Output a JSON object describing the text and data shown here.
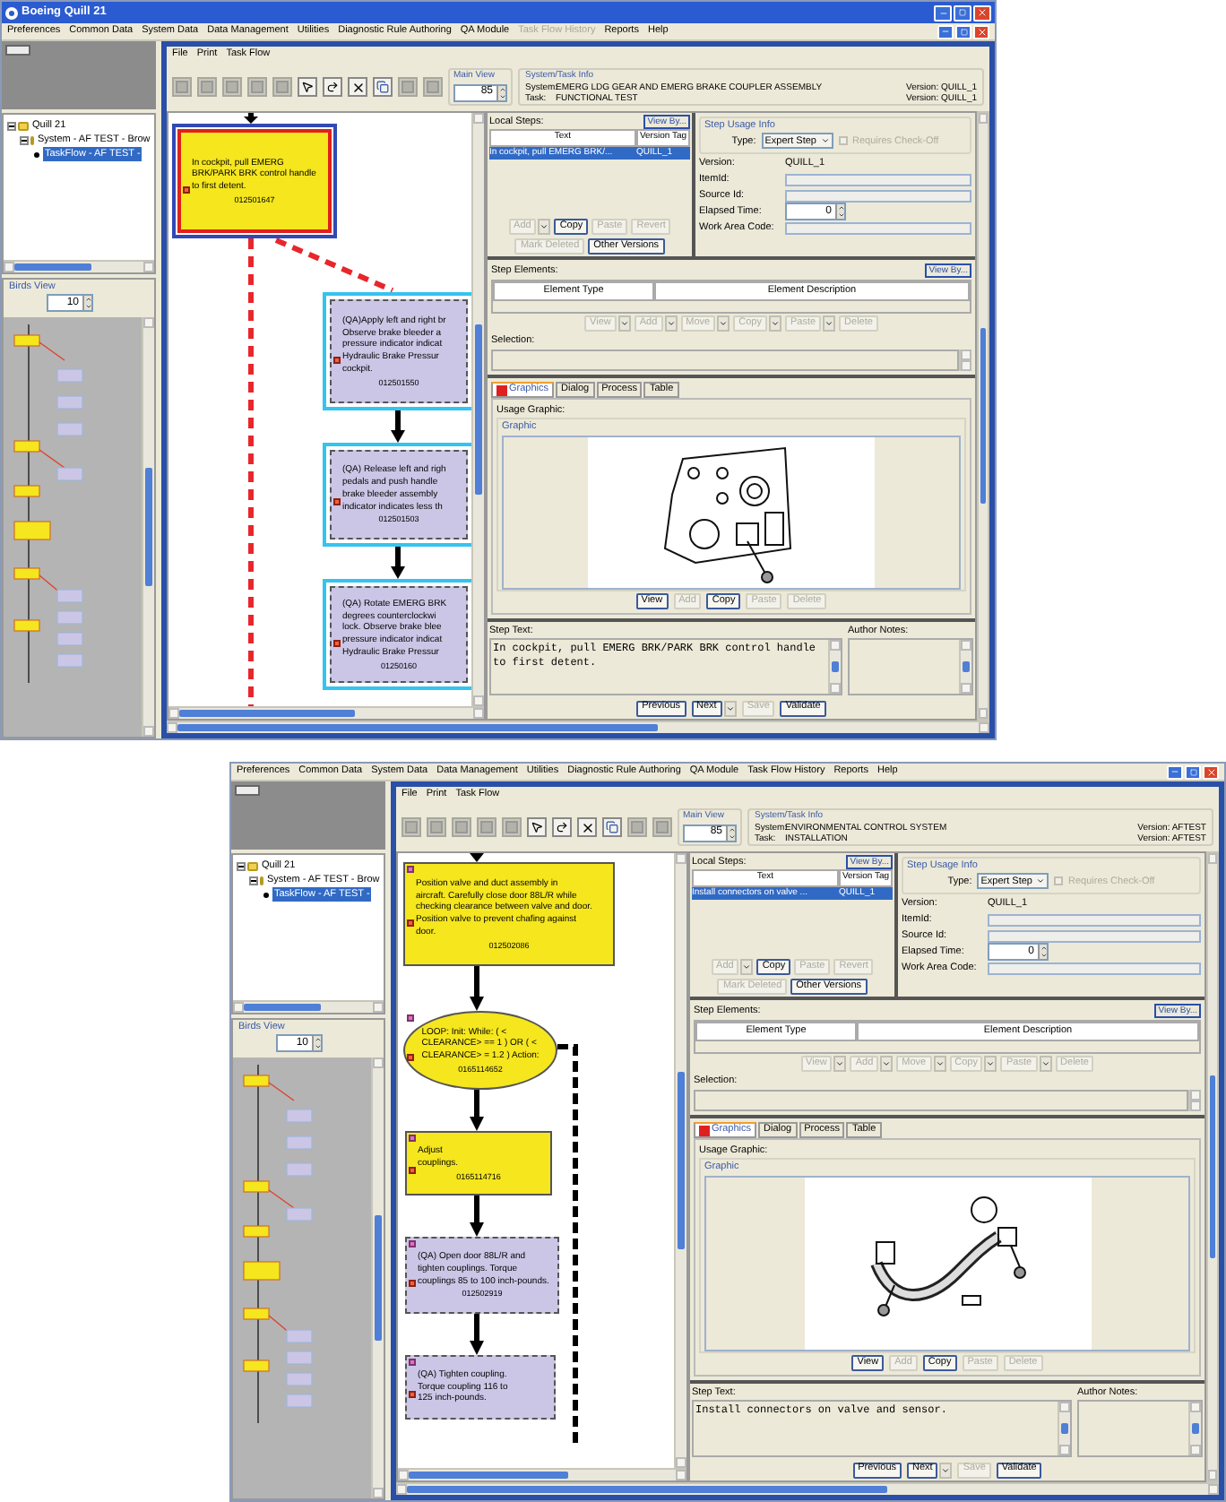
{
  "screens": [
    {
      "window": {
        "title": "Boeing Quill 21"
      },
      "menu": [
        {
          "label": "Preferences",
          "disabled": false
        },
        {
          "label": "Common Data",
          "disabled": false
        },
        {
          "label": "System Data",
          "disabled": false
        },
        {
          "label": "Data Management",
          "disabled": false
        },
        {
          "label": "Utilities",
          "disabled": false
        },
        {
          "label": "Diagnostic Rule Authoring",
          "disabled": false
        },
        {
          "label": "QA Module",
          "disabled": false
        },
        {
          "label": "Task Flow History",
          "disabled": true
        },
        {
          "label": "Reports",
          "disabled": false
        },
        {
          "label": "Help",
          "disabled": false
        }
      ],
      "tree": [
        {
          "label": "Quill 21",
          "expanded": true,
          "selected": false,
          "children": [
            {
              "label": "System - AF TEST - Brow",
              "expanded": true,
              "selected": false,
              "children": [
                {
                  "label": "TaskFlow - AF TEST -",
                  "selected": true
                }
              ]
            }
          ]
        }
      ],
      "birds_view": {
        "label": "Birds View",
        "zoom": "10"
      },
      "editor_menu": [
        "File",
        "Print",
        "Task Flow"
      ],
      "main_view": {
        "label": "Main View",
        "zoom": "85"
      },
      "system_task_info": {
        "heading": "System/Task Info",
        "rows": [
          {
            "label": "System:",
            "value": "EMERG LDG GEAR AND EMERG BRAKE COUPLER ASSEMBLY",
            "version": "Version:  QUILL_1"
          },
          {
            "label": "Task:",
            "value": "FUNCTIONAL TEST",
            "version": "Version:  QUILL_1"
          }
        ]
      },
      "flow_nodes": [
        {
          "kind": "step",
          "selected": true,
          "lines": [
            "In cockpit, pull EMERG",
            "BRK/PARK BRK control handle",
            "to first detent."
          ],
          "id": "012501647"
        },
        {
          "kind": "qa_step",
          "selected": false,
          "linked": true,
          "lines": [
            "(QA)Apply left and right br",
            "Observe brake bleeder a",
            "pressure indicator indicat",
            "Hydraulic Brake Pressur",
            "cockpit."
          ],
          "id": "012501550"
        },
        {
          "kind": "qa_step",
          "selected": false,
          "linked": true,
          "lines": [
            "(QA) Release left and righ",
            "pedals and push handle",
            "brake bleeder assembly",
            "indicator indicates less th"
          ],
          "id": "012501503"
        },
        {
          "kind": "qa_step",
          "selected": false,
          "linked": true,
          "lines": [
            "(QA) Rotate EMERG BRK",
            "degrees counterclockwi",
            "lock.  Observe brake blee",
            "pressure indicator indicat",
            "Hydraulic Brake Pressur"
          ],
          "id": "01250160"
        }
      ],
      "local_steps": {
        "label": "Local Steps:",
        "view_by": "View By...",
        "columns": [
          "Text",
          "Version Tag"
        ],
        "rows": [
          {
            "text": "In cockpit, pull EMERG BRK/...",
            "version_tag": "QUILL_1",
            "selected": true
          }
        ],
        "buttons": [
          {
            "label": "Add",
            "disabled": true,
            "has_menu": true
          },
          {
            "label": "Copy",
            "disabled": false,
            "has_menu": false
          },
          {
            "label": "Paste",
            "disabled": true,
            "has_menu": false
          },
          {
            "label": "Revert",
            "disabled": true,
            "has_menu": false
          },
          {
            "label": "Mark Deleted",
            "disabled": true,
            "has_menu": false
          },
          {
            "label": "Other Versions",
            "disabled": false,
            "has_menu": false
          }
        ]
      },
      "step_usage_info": {
        "heading": "Step Usage Info",
        "type_label": "Type:",
        "type_value": "Expert Step",
        "check_off": {
          "label": "Requires Check-Off",
          "checked": false,
          "disabled": true
        },
        "fields": [
          {
            "kind": "text",
            "label": "Version:",
            "value": "QUILL_1"
          },
          {
            "kind": "field",
            "label": "ItemId:"
          },
          {
            "kind": "field",
            "label": "Source Id:"
          },
          {
            "kind": "spinner",
            "label": "Elapsed Time:",
            "value": "0"
          },
          {
            "kind": "field",
            "label": "Work Area Code:"
          }
        ]
      },
      "step_elements": {
        "label": "Step Elements:",
        "view_by": "View By...",
        "columns": [
          "Element Type",
          "Element Description"
        ],
        "selection_label": "Selection:",
        "buttons": [
          {
            "label": "View",
            "disabled": true,
            "has_menu": true
          },
          {
            "label": "Add",
            "disabled": true,
            "has_menu": true
          },
          {
            "label": "Move",
            "disabled": true,
            "has_menu": true
          },
          {
            "label": "Copy",
            "disabled": true,
            "has_menu": true
          },
          {
            "label": "Paste",
            "disabled": true,
            "has_menu": true
          },
          {
            "label": "Delete",
            "disabled": true,
            "has_menu": false
          }
        ]
      },
      "tabs": [
        {
          "label": "Graphics",
          "selected": true
        },
        {
          "label": "Dialog",
          "selected": false
        },
        {
          "label": "Process",
          "selected": false
        },
        {
          "label": "Table",
          "selected": false
        }
      ],
      "usage_graphic": {
        "label": "Usage Graphic:",
        "group": "Graphic",
        "kind": "panel",
        "buttons": [
          {
            "label": "View",
            "disabled": false,
            "has_menu": false
          },
          {
            "label": "Add",
            "disabled": true,
            "has_menu": false
          },
          {
            "label": "Copy",
            "disabled": false,
            "has_menu": false
          },
          {
            "label": "Paste",
            "disabled": true,
            "has_menu": false
          },
          {
            "label": "Delete",
            "disabled": true,
            "has_menu": false
          }
        ]
      },
      "step_text": {
        "label": "Step Text:",
        "value": "In cockpit, pull EMERG BRK/PARK BRK control handle to first detent."
      },
      "author_notes": {
        "label": "Author Notes:"
      },
      "nav_buttons": [
        {
          "label": "Previous",
          "disabled": false,
          "has_menu": false
        },
        {
          "label": "Next",
          "disabled": false,
          "has_menu": true
        },
        {
          "label": "Save",
          "disabled": true,
          "has_menu": false
        },
        {
          "label": "Validate",
          "disabled": false,
          "has_menu": false
        }
      ]
    },
    {
      "menu": [
        {
          "label": "Preferences",
          "disabled": false
        },
        {
          "label": "Common Data",
          "disabled": false
        },
        {
          "label": "System Data",
          "disabled": false
        },
        {
          "label": "Data Management",
          "disabled": false
        },
        {
          "label": "Utilities",
          "disabled": false
        },
        {
          "label": "Diagnostic Rule Authoring",
          "disabled": false
        },
        {
          "label": "QA Module",
          "disabled": false
        },
        {
          "label": "Task Flow History",
          "disabled": false
        },
        {
          "label": "Reports",
          "disabled": false
        },
        {
          "label": "Help",
          "disabled": false
        }
      ],
      "tree": [
        {
          "label": "Quill 21",
          "expanded": true,
          "selected": false,
          "children": [
            {
              "label": "System - AF TEST - Brow",
              "expanded": true,
              "selected": false,
              "children": [
                {
                  "label": "TaskFlow - AF TEST -",
                  "selected": true
                }
              ]
            }
          ]
        }
      ],
      "birds_view": {
        "label": "Birds View",
        "zoom": "10"
      },
      "editor_menu": [
        "File",
        "Print",
        "Task Flow"
      ],
      "main_view": {
        "label": "Main View",
        "zoom": "85"
      },
      "system_task_info": {
        "heading": "System/Task Info",
        "rows": [
          {
            "label": "System:",
            "value": "ENVIRONMENTAL CONTROL SYSTEM",
            "version": "Version:  AFTEST"
          },
          {
            "label": "Task:",
            "value": "INSTALLATION",
            "version": "Version:  AFTEST"
          }
        ]
      },
      "flow_nodes": [
        {
          "kind": "step",
          "selected": false,
          "linked": false,
          "lines": [
            "Position valve and duct assembly in",
            "aircraft. Carefully close door 88L/R while",
            "checking clearance between valve and door.",
            "Position valve to prevent chafing against",
            "door."
          ],
          "id": "012502086"
        },
        {
          "kind": "loop",
          "selected": false,
          "linked": false,
          "lines": [
            "LOOP: Init:  While: ( <",
            "CLEARANCE> == 1 ) OR ( <",
            "CLEARANCE> = 1.2 )  Action:"
          ],
          "id": "0165114652"
        },
        {
          "kind": "step",
          "selected": false,
          "linked": false,
          "lines": [
            "Adjust",
            "couplings."
          ],
          "id": "0165114716"
        },
        {
          "kind": "qa_step",
          "selected": false,
          "linked": false,
          "lines": [
            "(QA) Open door 88L/R and",
            "tighten couplings. Torque",
            "couplings 85 to 100 inch-pounds."
          ],
          "id": "012502919"
        },
        {
          "kind": "qa_step",
          "selected": false,
          "linked": false,
          "lines": [
            "(QA) Tighten coupling.",
            "Torque coupling 116 to",
            "125 inch-pounds."
          ]
        }
      ],
      "local_steps": {
        "label": "Local Steps:",
        "view_by": "View By...",
        "columns": [
          "Text",
          "Version Tag"
        ],
        "rows": [
          {
            "text": "Install connectors on valve ...",
            "version_tag": "QUILL_1",
            "selected": true
          }
        ],
        "buttons": [
          {
            "label": "Add",
            "disabled": true,
            "has_menu": true
          },
          {
            "label": "Copy",
            "disabled": false,
            "has_menu": false
          },
          {
            "label": "Paste",
            "disabled": true,
            "has_menu": false
          },
          {
            "label": "Revert",
            "disabled": true,
            "has_menu": false
          },
          {
            "label": "Mark Deleted",
            "disabled": true,
            "has_menu": false
          },
          {
            "label": "Other Versions",
            "disabled": false,
            "has_menu": false
          }
        ]
      },
      "step_usage_info": {
        "heading": "Step Usage Info",
        "type_label": "Type:",
        "type_value": "Expert Step",
        "check_off": {
          "label": "Requires Check-Off",
          "checked": false,
          "disabled": true
        },
        "fields": [
          {
            "kind": "text",
            "label": "Version:",
            "value": "QUILL_1"
          },
          {
            "kind": "field",
            "label": "ItemId:"
          },
          {
            "kind": "field",
            "label": "Source Id:"
          },
          {
            "kind": "spinner",
            "label": "Elapsed Time:",
            "value": "0"
          },
          {
            "kind": "field",
            "label": "Work Area Code:"
          }
        ]
      },
      "step_elements": {
        "label": "Step Elements:",
        "view_by": "View By...",
        "columns": [
          "Element Type",
          "Element Description"
        ],
        "selection_label": "Selection:",
        "buttons": [
          {
            "label": "View",
            "disabled": true,
            "has_menu": true
          },
          {
            "label": "Add",
            "disabled": true,
            "has_menu": true
          },
          {
            "label": "Move",
            "disabled": true,
            "has_menu": true
          },
          {
            "label": "Copy",
            "disabled": true,
            "has_menu": true
          },
          {
            "label": "Paste",
            "disabled": true,
            "has_menu": true
          },
          {
            "label": "Delete",
            "disabled": true,
            "has_menu": false
          }
        ]
      },
      "tabs": [
        {
          "label": "Graphics",
          "selected": true
        },
        {
          "label": "Dialog",
          "selected": false
        },
        {
          "label": "Process",
          "selected": false
        },
        {
          "label": "Table",
          "selected": false
        }
      ],
      "usage_graphic": {
        "label": "Usage Graphic:",
        "group": "Graphic",
        "kind": "duct",
        "buttons": [
          {
            "label": "View",
            "disabled": false,
            "has_menu": false
          },
          {
            "label": "Add",
            "disabled": true,
            "has_menu": false
          },
          {
            "label": "Copy",
            "disabled": false,
            "has_menu": false
          },
          {
            "label": "Paste",
            "disabled": true,
            "has_menu": false
          },
          {
            "label": "Delete",
            "disabled": true,
            "has_menu": false
          }
        ]
      },
      "step_text": {
        "label": "Step Text:",
        "value": "Install connectors on valve and sensor."
      },
      "author_notes": {
        "label": "Author Notes:"
      },
      "nav_buttons": [
        {
          "label": "Previous",
          "disabled": false,
          "has_menu": false
        },
        {
          "label": "Next",
          "disabled": false,
          "has_menu": true
        },
        {
          "label": "Save",
          "disabled": true,
          "has_menu": false
        },
        {
          "label": "Validate",
          "disabled": false,
          "has_menu": false
        }
      ]
    }
  ]
}
